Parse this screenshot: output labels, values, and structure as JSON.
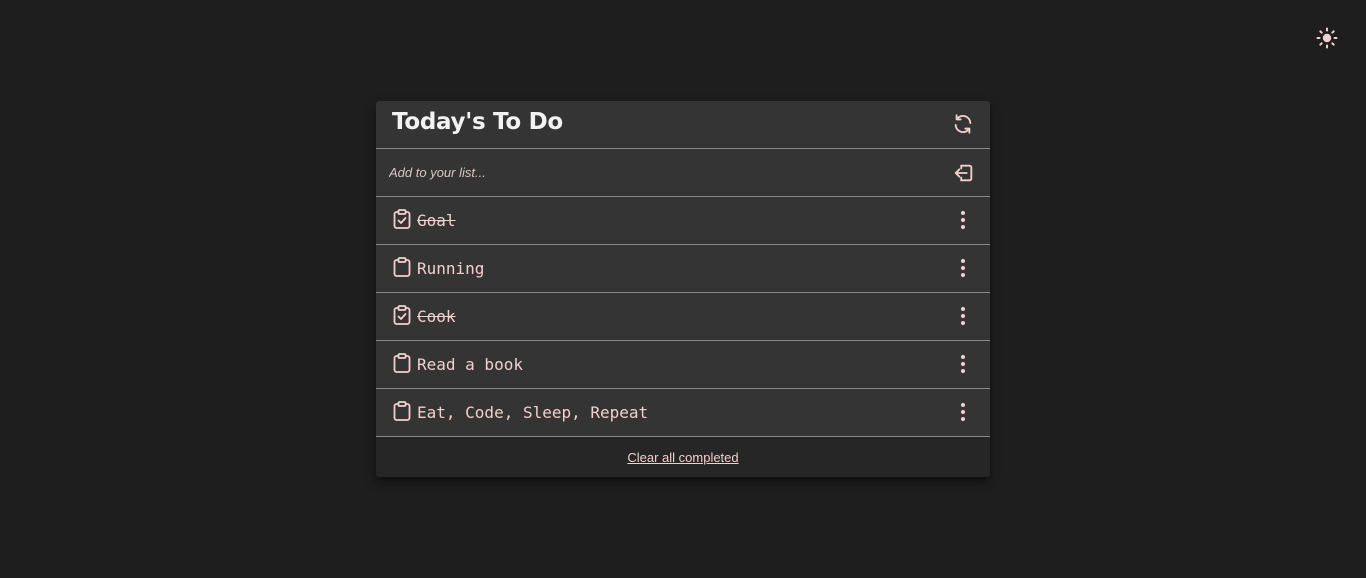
{
  "theme_toggle": {
    "icon": "sun-icon"
  },
  "app": {
    "title": "Today's To Do",
    "refresh_icon": "refresh-icon",
    "add_icon": "enter-icon"
  },
  "input": {
    "placeholder": "Add to your list...",
    "value": ""
  },
  "todos": [
    {
      "text": "Goal",
      "completed": true
    },
    {
      "text": "Running",
      "completed": false
    },
    {
      "text": "Cook",
      "completed": true
    },
    {
      "text": "Read a book",
      "completed": false
    },
    {
      "text": "Eat, Code, Sleep, Repeat",
      "completed": false
    }
  ],
  "footer": {
    "clear_label": "Clear all completed"
  },
  "colors": {
    "background": "#1e1e1e",
    "card": "#343434",
    "accent": "#f3cfcf",
    "divider": "#8a8a8a"
  }
}
